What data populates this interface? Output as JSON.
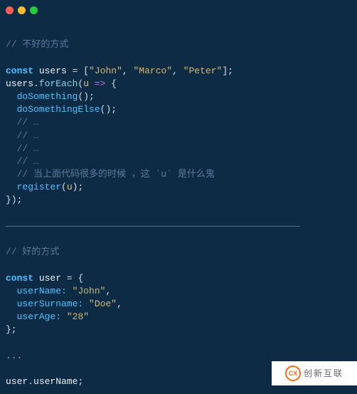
{
  "titlebar": {
    "dots": [
      "red",
      "yellow",
      "green"
    ]
  },
  "code": {
    "line1_comment": "// 不好的方式",
    "line3_const": "const",
    "line3_users": "users",
    "line3_eq": " = [",
    "line3_s1": "\"John\"",
    "line3_c1": ", ",
    "line3_s2": "\"Marco\"",
    "line3_c2": ", ",
    "line3_s3": "\"Peter\"",
    "line3_end": "];",
    "line4_users": "users",
    "line4_dot": ".",
    "line4_foreach": "forEach",
    "line4_open": "(",
    "line4_u": "u",
    "line4_arrow": " => ",
    "line4_brace": "{",
    "line5_fn": "doSomething",
    "line5_call": "();",
    "line6_fn": "doSomethingElse",
    "line6_call": "();",
    "line7": "// …",
    "line8": "// …",
    "line9": "// …",
    "line10": "// …",
    "line11": "// 当上面代码很多的时候 ，这 `u` 是什么鬼",
    "line12_fn": "register",
    "line12_open": "(",
    "line12_u": "u",
    "line12_close": ");",
    "line13": "});",
    "divider": "—————————————————————————————————————————————————————",
    "line15": "// 好的方式",
    "line17_const": "const",
    "line17_user": "user",
    "line17_rest": " = {",
    "line18_key": "userName:",
    "line18_val": "\"John\"",
    "line18_c": ",",
    "line19_key": "userSurname:",
    "line19_val": "\"Doe\"",
    "line19_c": ",",
    "line20_key": "userAge:",
    "line20_val": "\"28\"",
    "line21": "};",
    "line23": "...",
    "line25_user": "user",
    "line25_dot": ".",
    "line25_prop": "userName",
    "line25_semi": ";"
  },
  "watermark": {
    "logo": "CX",
    "text": "创新互联"
  }
}
